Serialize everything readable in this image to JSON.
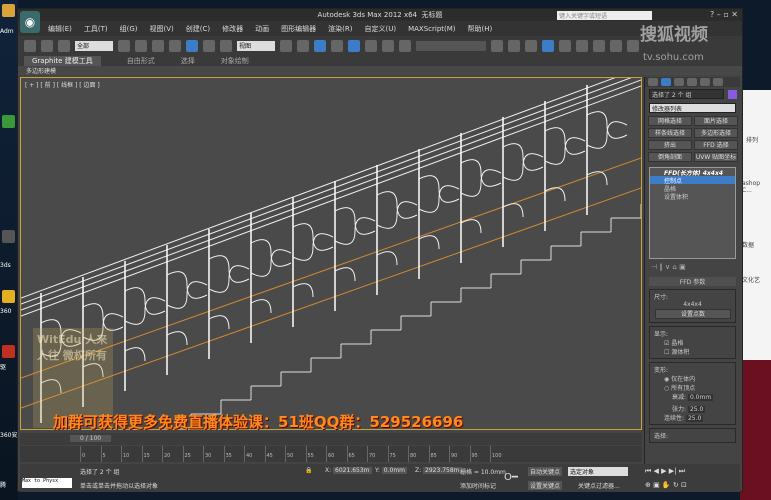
{
  "desktop": {
    "labels": [
      "Adm",
      "3ds",
      "360",
      "驱",
      "360安",
      "腾"
    ]
  },
  "window": {
    "title": "Autodesk 3ds Max  2012 x64",
    "doc": "无标题",
    "search_placeholder": "键入关键字或短语"
  },
  "menu": [
    "编辑(E)",
    "工具(T)",
    "组(G)",
    "视图(V)",
    "创建(C)",
    "修改器",
    "动画",
    "图形编辑器",
    "渲染(R)",
    "自定义(U)",
    "MAXScript(M)",
    "帮助(H)"
  ],
  "toolbar": {
    "filter": "全部",
    "coord": "视图",
    "named_sel": ""
  },
  "ribbon": {
    "tabs": [
      "Graphite 建模工具",
      "自由形式",
      "选择",
      "对象绘制"
    ],
    "sub": "多边形建模"
  },
  "viewport": {
    "label": "[ + ] [ 前 ] [ 线框 ] [ 边面 ]"
  },
  "overlay": "加群可获得更多免费直播体验课：51班QQ群：529526696",
  "watermark": {
    "brand": "搜狐视频",
    "url": "tv.sohu.com",
    "left": "WitEdu 人来人往 微权所有"
  },
  "command_panel": {
    "selection": "选择了 2 个 组",
    "modifier_list": "修改器列表",
    "buttons": [
      "网格选择",
      "面片选择",
      "样条线选择",
      "多边形选择",
      "挤出",
      "FFD 选择",
      "倒角剖面",
      "UVW 贴图坐标"
    ],
    "stack": {
      "top": "FFD(长方体) 4x4x4",
      "items": [
        "控制点",
        "晶格",
        "设置体积"
      ]
    },
    "ffd": {
      "title": "FFD 参数",
      "dim_label": "尺寸:",
      "dim": "4x4x4",
      "set_points": "设置点数",
      "display_label": "显示:",
      "lattice": "晶格",
      "source_volume": "源体积",
      "deform_label": "变形:",
      "only_in_volume": "仅在体内",
      "all_vertices": "所有顶点",
      "falloff_label": "衰减:",
      "falloff": "0.0mm",
      "tension_label": "张力:",
      "tension": "25.0",
      "continuity_label": "连续性:",
      "continuity": "25.0",
      "select_label": "选择:"
    }
  },
  "timeline": {
    "frame": "0 / 100",
    "ticks": [
      "0",
      "5",
      "10",
      "15",
      "20",
      "25",
      "30",
      "35",
      "40",
      "45",
      "50",
      "55",
      "60",
      "65",
      "70",
      "75",
      "80",
      "85",
      "90",
      "95",
      "100"
    ]
  },
  "status": {
    "maxscript": "Max to Physx",
    "selected": "选择了 2 个 组",
    "prompt": "单击或单击并拖动以选择对象",
    "x": "6021.653m",
    "y": "0.0mm",
    "z": "2923.758m",
    "grid": "栅格 = 10.0mm",
    "add_time_tag": "添加时间标记",
    "auto_key": "自动关键点",
    "set_key": "设置关键点",
    "key_mode": "选定对象",
    "key_filters": "关键点过滤器..."
  },
  "web": {
    "texts": [
      "排列",
      "ashop C...",
      "数据",
      "文化艺"
    ]
  }
}
